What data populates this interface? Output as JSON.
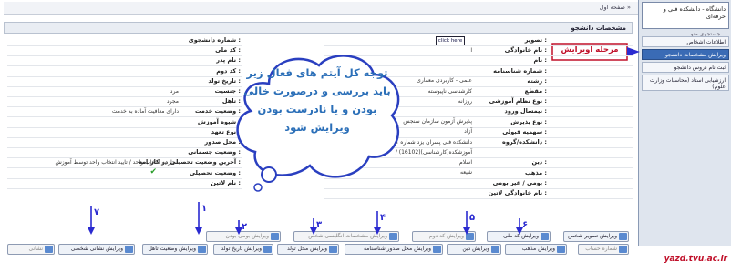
{
  "breadcrumb": "صفحه اول »",
  "sidebar": {
    "university": "دانشگاه - دانشکده فنی و حرفه‌ای",
    "search_label": "جستجوی منو...",
    "items": [
      {
        "label": "اطلاعات اشخاص"
      },
      {
        "label": "ویرایش مشخصات دانشجو"
      },
      {
        "label": "ثبت نام دروس دانشجو"
      },
      {
        "label": "ارزشیابی استاد (محاسبات وزارت علوم)"
      }
    ]
  },
  "annotation": {
    "stage_label": "مرحله اویرایش",
    "cloud_text": "توجه کل آیتم های فعال زیر باید بررسی و درصورت خالی بودن و یا نادرست بودن ویرایش شود"
  },
  "panel": {
    "title": "مشخصات دانشجو"
  },
  "right_fields": [
    {
      "label": "تصویر :",
      "value": "click here"
    },
    {
      "label": "نام خانوادگی :",
      "value": "ا"
    },
    {
      "label": "نام :",
      "value": ""
    },
    {
      "label": "شماره شناسنامه :",
      "value": ""
    },
    {
      "label": "رشته :",
      "value": "علمی - کاربردی معماری"
    },
    {
      "label": "مقطع :",
      "value": "کارشناسی ناپیوسته"
    },
    {
      "label": "نوع نظام آموزشی :",
      "value": "روزانه"
    },
    {
      "label": "نیمسال ورود :",
      "value": ""
    },
    {
      "label": "نوع پذیرش :",
      "value": "پذیرش آزمون سازمان سنجش"
    },
    {
      "label": "سهمیه قبولی :",
      "value": "آزاد"
    },
    {
      "label": "دانشکده/گروه :",
      "value": "161-دانشکده فنی پسران یزد شماره ۱ (شهید صدوقی)(161)"
    },
    {
      "label": "",
      "value": "/ آموزشکده(کارشناسی)(16102)"
    },
    {
      "label": "دین :",
      "value": "اسلام"
    },
    {
      "label": "مذهب :",
      "value": "شیعه"
    },
    {
      "label": "بومی / غیر بومی :",
      "value": ""
    },
    {
      "label": "نام خانوادگی لاتین :",
      "value": ""
    }
  ],
  "left_fields": [
    {
      "label": "شماره دانشجوی :",
      "value": ""
    },
    {
      "label": "کد ملی :",
      "value": ""
    },
    {
      "label": "نام پدر :",
      "value": ""
    },
    {
      "label": "کد دوم :",
      "value": ""
    },
    {
      "label": "تاریخ تولد :",
      "value": ""
    },
    {
      "label": "جنسیت :",
      "value": "مرد"
    },
    {
      "label": "تاهل :",
      "value": "مجرد"
    },
    {
      "label": "وضعیت خدمت :",
      "value": "دارای معافیت آماده به خدمت"
    },
    {
      "label": "شیوه آموزش :",
      "value": ""
    },
    {
      "label": "نوع تعهد :",
      "value": ""
    },
    {
      "label": "محل صدور :",
      "value": ""
    },
    {
      "label": "وضعیت جسمانی :",
      "value": ""
    },
    {
      "label": "آخرین وضعیت تحصیلی در کارنامه :",
      "value": "مجاز به انتخاب واحد / تایید انتخاب واحد توسط آموزش"
    },
    {
      "label": "وضعیت تحصیلی :",
      "value": "✔"
    },
    {
      "label": "نام لاتین :",
      "value": ""
    }
  ],
  "buttons_row1": [
    {
      "label": "ویرایش تصویر شخص",
      "dim": false
    },
    {
      "label": "ویرایش کد ملی",
      "dim": false
    },
    {
      "label": "ویرایش کد دوم",
      "dim": true
    },
    {
      "label": "ویرایش مشخصات انگلیسی شخص",
      "dim": true
    },
    {
      "label": "ویرایش بومی بودن",
      "dim": true
    }
  ],
  "buttons_row2": [
    {
      "label": "شماره حساب",
      "dim": true
    },
    {
      "label": "ویرایش مذهب",
      "dim": false
    },
    {
      "label": "ویرایش دین",
      "dim": false
    },
    {
      "label": "ویرایش محل صدور شناسنامه",
      "dim": false
    },
    {
      "label": "ویرایش محل تولد",
      "dim": false
    },
    {
      "label": "ویرایش تاریخ تولد",
      "dim": false
    },
    {
      "label": "ویرایش وضعیت تاهل",
      "dim": false
    },
    {
      "label": "ویرایش نشانی شخصی",
      "dim": false
    },
    {
      "label": "نشانی",
      "dim": true
    }
  ],
  "markers": [
    "۱",
    "۲",
    "۳",
    "۴",
    "۵",
    "۶",
    "۷"
  ],
  "footer": "yazd.tvu.ac.ir",
  "colors": {
    "accent": "#3a6bb5",
    "marker": "#2a2ad0",
    "footer": "#c0102a",
    "cloud_text": "#2b6fb8"
  }
}
